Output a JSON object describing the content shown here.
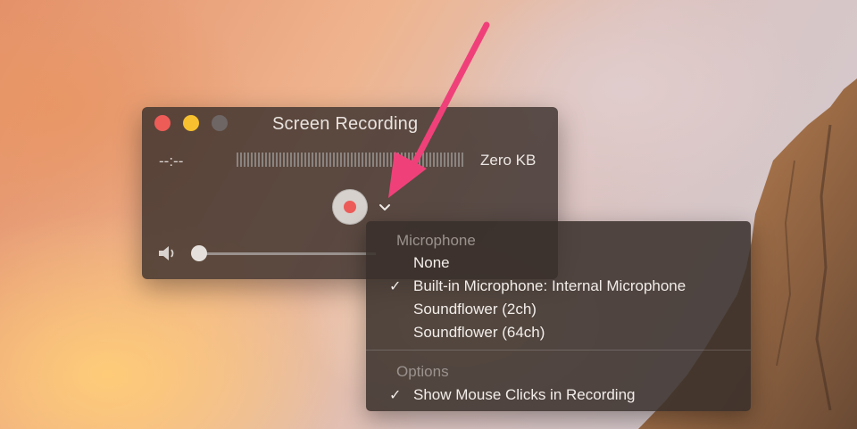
{
  "window": {
    "title": "Screen Recording",
    "elapsed": "--:--",
    "file_size": "Zero KB"
  },
  "controls": {
    "record_icon": "record-icon",
    "options_icon": "chevron-down-icon",
    "volume_icon": "speaker-icon",
    "volume_level": 0
  },
  "menu": {
    "microphone_header": "Microphone",
    "items": [
      {
        "label": "None",
        "checked": false
      },
      {
        "label": "Built-in Microphone: Internal Microphone",
        "checked": true
      },
      {
        "label": "Soundflower (2ch)",
        "checked": false
      },
      {
        "label": "Soundflower (64ch)",
        "checked": false
      }
    ],
    "options_header": "Options",
    "options_items": [
      {
        "label": "Show Mouse Clicks in Recording",
        "checked": true
      }
    ],
    "check_glyph": "✓"
  },
  "colors": {
    "record_red": "#ec5b58",
    "annotation_arrow": "#f0407a"
  }
}
